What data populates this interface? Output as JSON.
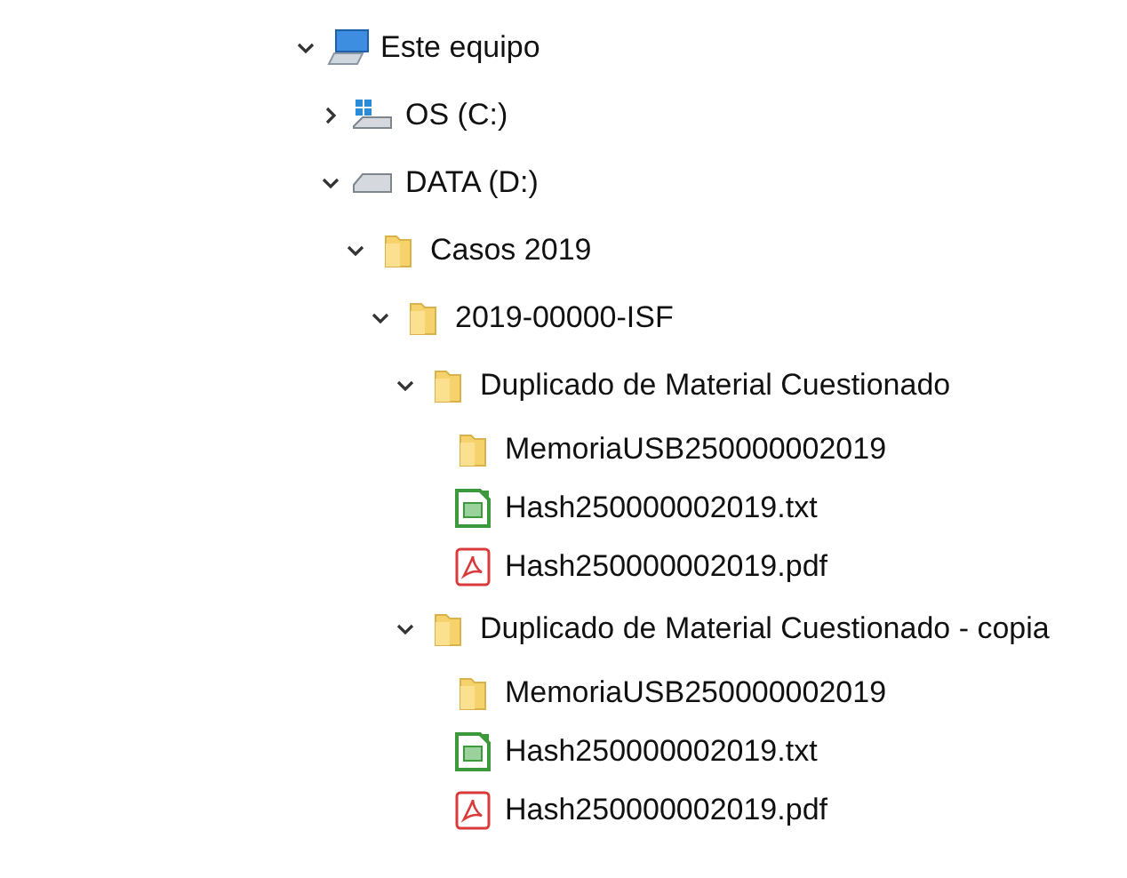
{
  "tree": [
    {
      "kind": "computer",
      "label": "Este equipo",
      "expanded": true,
      "children": [
        {
          "kind": "system-drive",
          "label": "OS (C:)",
          "expanded": false
        },
        {
          "kind": "drive",
          "label": "DATA (D:)",
          "expanded": true,
          "children": [
            {
              "kind": "folder",
              "label": "Casos 2019",
              "expanded": true,
              "children": [
                {
                  "kind": "folder",
                  "label": "2019-00000-ISF",
                  "expanded": true,
                  "children": [
                    {
                      "kind": "folder",
                      "label": "Duplicado de Material Cuestionado",
                      "expanded": true,
                      "children": [
                        {
                          "kind": "folder",
                          "label": "MemoriaUSB250000002019"
                        },
                        {
                          "kind": "text-file",
                          "label": "Hash250000002019.txt"
                        },
                        {
                          "kind": "pdf-file",
                          "label": "Hash250000002019.pdf"
                        }
                      ]
                    },
                    {
                      "kind": "folder",
                      "label": "Duplicado de Material Cuestionado - copia",
                      "expanded": true,
                      "children": [
                        {
                          "kind": "folder",
                          "label": "MemoriaUSB250000002019"
                        },
                        {
                          "kind": "text-file",
                          "label": "Hash250000002019.txt"
                        },
                        {
                          "kind": "pdf-file",
                          "label": "Hash250000002019.pdf"
                        }
                      ]
                    }
                  ]
                }
              ]
            }
          ]
        }
      ]
    }
  ]
}
